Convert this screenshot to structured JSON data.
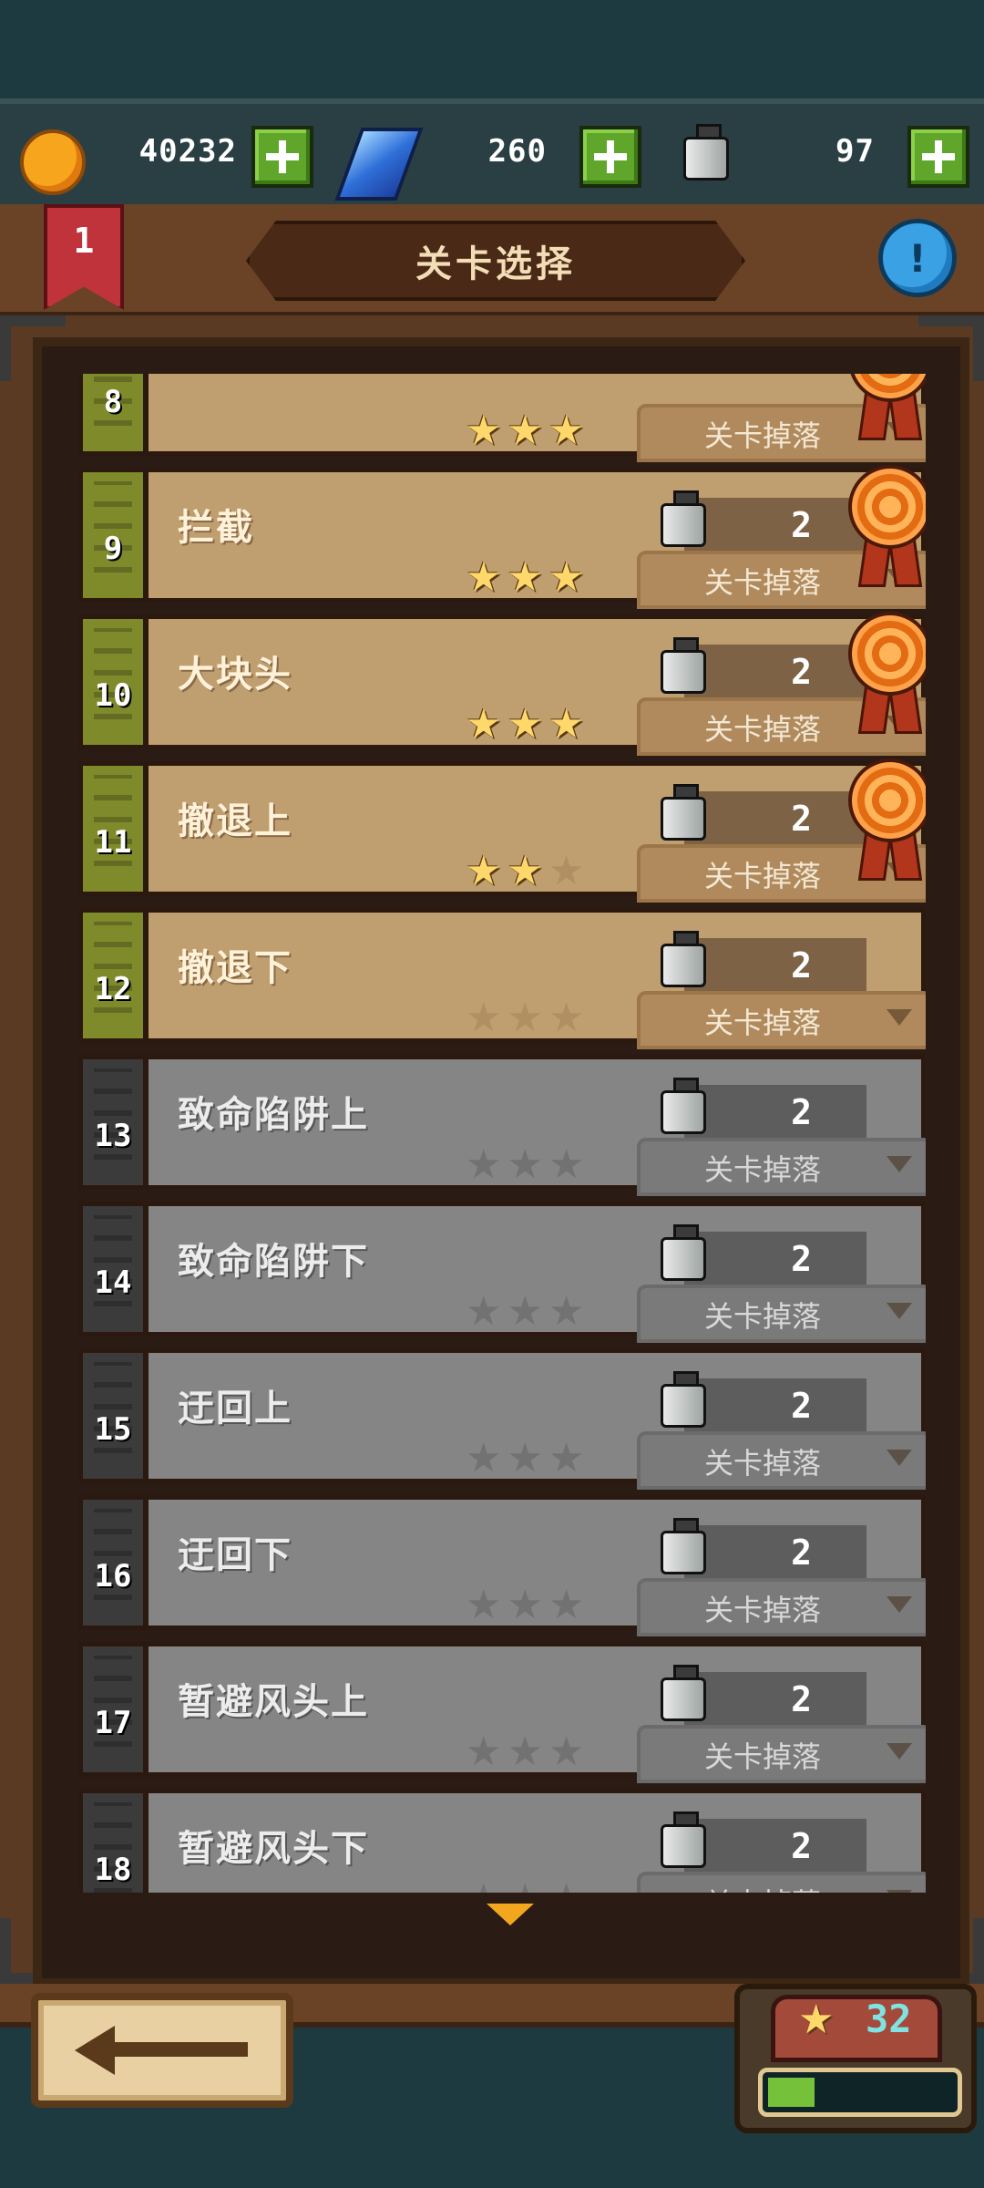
{
  "resources": {
    "coins": "40232",
    "gems": "260",
    "bottles": "97"
  },
  "header": {
    "title": "关卡选择",
    "chapter_number": "1",
    "help_symbol": "!"
  },
  "drop_label": "关卡掉落",
  "levels": [
    {
      "number": "8",
      "name": "",
      "stars": 3,
      "reward": "",
      "completed": true,
      "medal": true
    },
    {
      "number": "9",
      "name": "拦截",
      "stars": 3,
      "reward": "2",
      "completed": true,
      "medal": true
    },
    {
      "number": "10",
      "name": "大块头",
      "stars": 3,
      "reward": "2",
      "completed": true,
      "medal": true
    },
    {
      "number": "11",
      "name": "撤退上",
      "stars": 2,
      "reward": "2",
      "completed": true,
      "medal": true
    },
    {
      "number": "12",
      "name": "撤退下",
      "stars": 0,
      "reward": "2",
      "completed": true,
      "medal": false
    },
    {
      "number": "13",
      "name": "致命陷阱上",
      "stars": 0,
      "reward": "2",
      "completed": false,
      "medal": false
    },
    {
      "number": "14",
      "name": "致命陷阱下",
      "stars": 0,
      "reward": "2",
      "completed": false,
      "medal": false
    },
    {
      "number": "15",
      "name": "迂回上",
      "stars": 0,
      "reward": "2",
      "completed": false,
      "medal": false
    },
    {
      "number": "16",
      "name": "迂回下",
      "stars": 0,
      "reward": "2",
      "completed": false,
      "medal": false
    },
    {
      "number": "17",
      "name": "暂避风头上",
      "stars": 0,
      "reward": "2",
      "completed": false,
      "medal": false
    },
    {
      "number": "18",
      "name": "暂避风头下",
      "stars": 0,
      "reward": "2",
      "completed": false,
      "medal": false
    }
  ],
  "footer": {
    "star_total": "32",
    "star_progress": 0.25
  },
  "icons": {
    "coin": "coin-icon",
    "gem": "gem-icon",
    "bottle": "bottle-icon",
    "star": "star-icon",
    "medal": "medal-icon",
    "back": "back-arrow-icon"
  },
  "colors": {
    "completed_row": "#bf9e6f",
    "locked_row": "#858585",
    "star_on": "#ffd86b",
    "plus_green": "#5fa62a"
  }
}
